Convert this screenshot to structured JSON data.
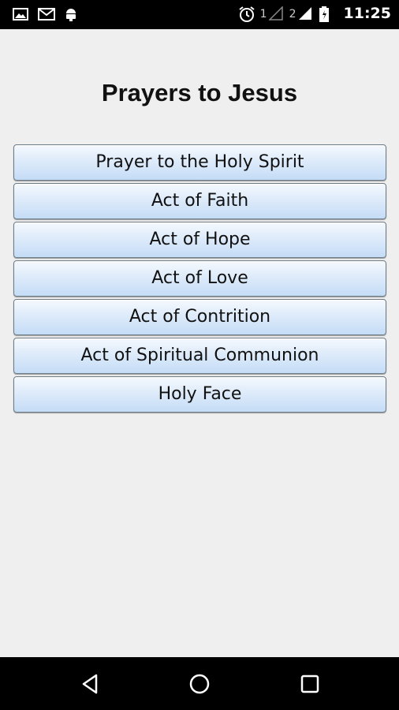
{
  "status_bar": {
    "icons": [
      "image-icon",
      "gmail-icon",
      "android-icon",
      "alarm-icon",
      "signal-icon",
      "battery-icon"
    ],
    "sim1": "1",
    "sim2": "2",
    "time": "11:25"
  },
  "title": "Prayers to Jesus",
  "buttons": [
    "Prayer to the Holy Spirit",
    "Act of Faith",
    "Act of Hope",
    "Act of Love",
    "Act of Contrition",
    "Act of Spiritual Communion",
    "Holy Face"
  ],
  "nav": {
    "icons": [
      "back-icon",
      "home-icon",
      "recent-apps-icon"
    ]
  },
  "colors": {
    "background": "#efefef",
    "button_top": "#f5f9fe",
    "button_bottom": "#c4dcf6",
    "bar": "#000000"
  }
}
